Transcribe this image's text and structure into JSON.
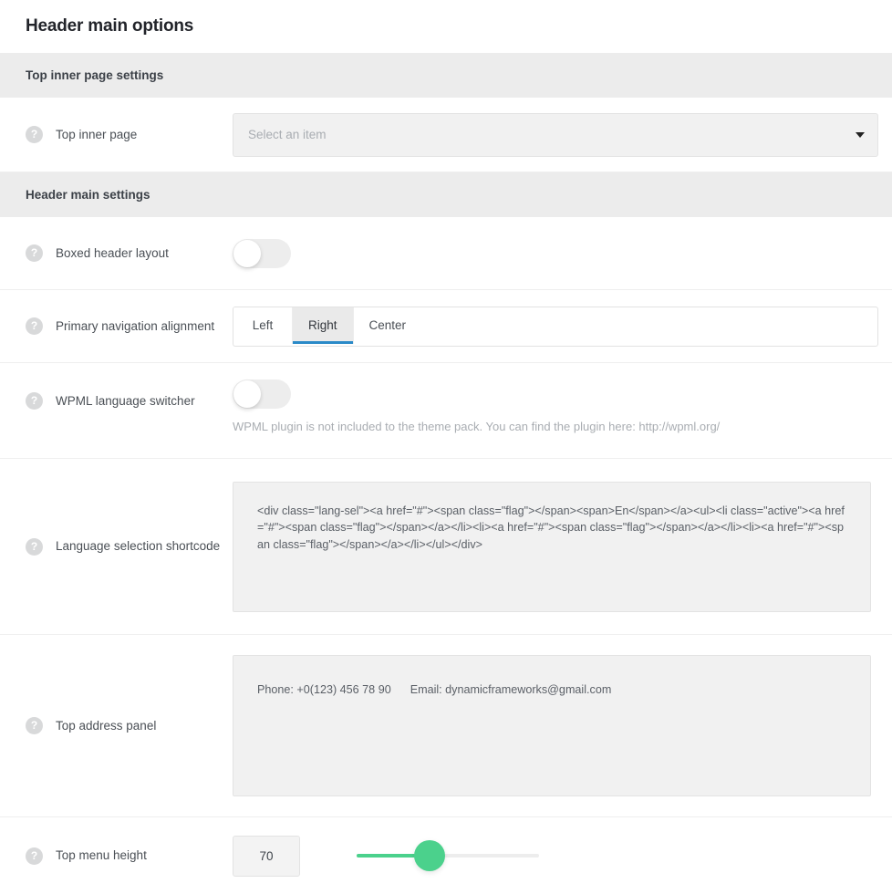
{
  "page": {
    "title": "Header main options"
  },
  "sections": [
    {
      "heading": "Top inner page settings",
      "rows": [
        {
          "label": "Top inner page",
          "help_icon": "question-mark-icon",
          "control": "select",
          "placeholder": "Select an item",
          "caret_icon": "chevron-down-icon"
        }
      ]
    },
    {
      "heading": "Header main settings",
      "rows": [
        {
          "label": "Boxed header layout",
          "help_icon": "question-mark-icon",
          "control": "toggle",
          "state": "off"
        },
        {
          "label": "Primary navigation alignment",
          "help_icon": "question-mark-icon",
          "control": "button-group",
          "options": [
            "Left",
            "Right",
            "Center"
          ],
          "selected": "Right"
        },
        {
          "label": "WPML language switcher",
          "help_icon": "question-mark-icon",
          "control": "toggle",
          "state": "off",
          "note": "WPML plugin is not included to the theme pack. You can find the plugin here: http://wpml.org/"
        },
        {
          "label": "Language selection shortcode",
          "help_icon": "question-mark-icon",
          "control": "textarea",
          "value": "<div class=\"lang-sel\"><a href=\"#\"><span class=\"flag\"></span><span>En</span></a><ul><li class=\"active\"><a href=\"#\"><span class=\"flag\"></span></a></li><li><a href=\"#\"><span class=\"flag\"></span></a></li><li><a href=\"#\"><span class=\"flag\"></span></a></li></ul></div>"
        },
        {
          "label": "Top address panel",
          "help_icon": "question-mark-icon",
          "control": "textarea",
          "value": "Phone: +0(123) 456 78 90      Email: dynamicframeworks@gmail.com"
        },
        {
          "label": "Top menu height",
          "help_icon": "question-mark-icon",
          "control": "slider",
          "value": "70",
          "slider_percent": 40
        }
      ]
    }
  ],
  "icons": {
    "help": "?",
    "resize_handle": "resize-grip-icon"
  },
  "colors": {
    "accent_blue": "#2a8ac8",
    "slider_green": "#4bd18c",
    "section_band": "#ececec",
    "field_bg": "#f1f1f1",
    "title_text": "#22242a"
  }
}
